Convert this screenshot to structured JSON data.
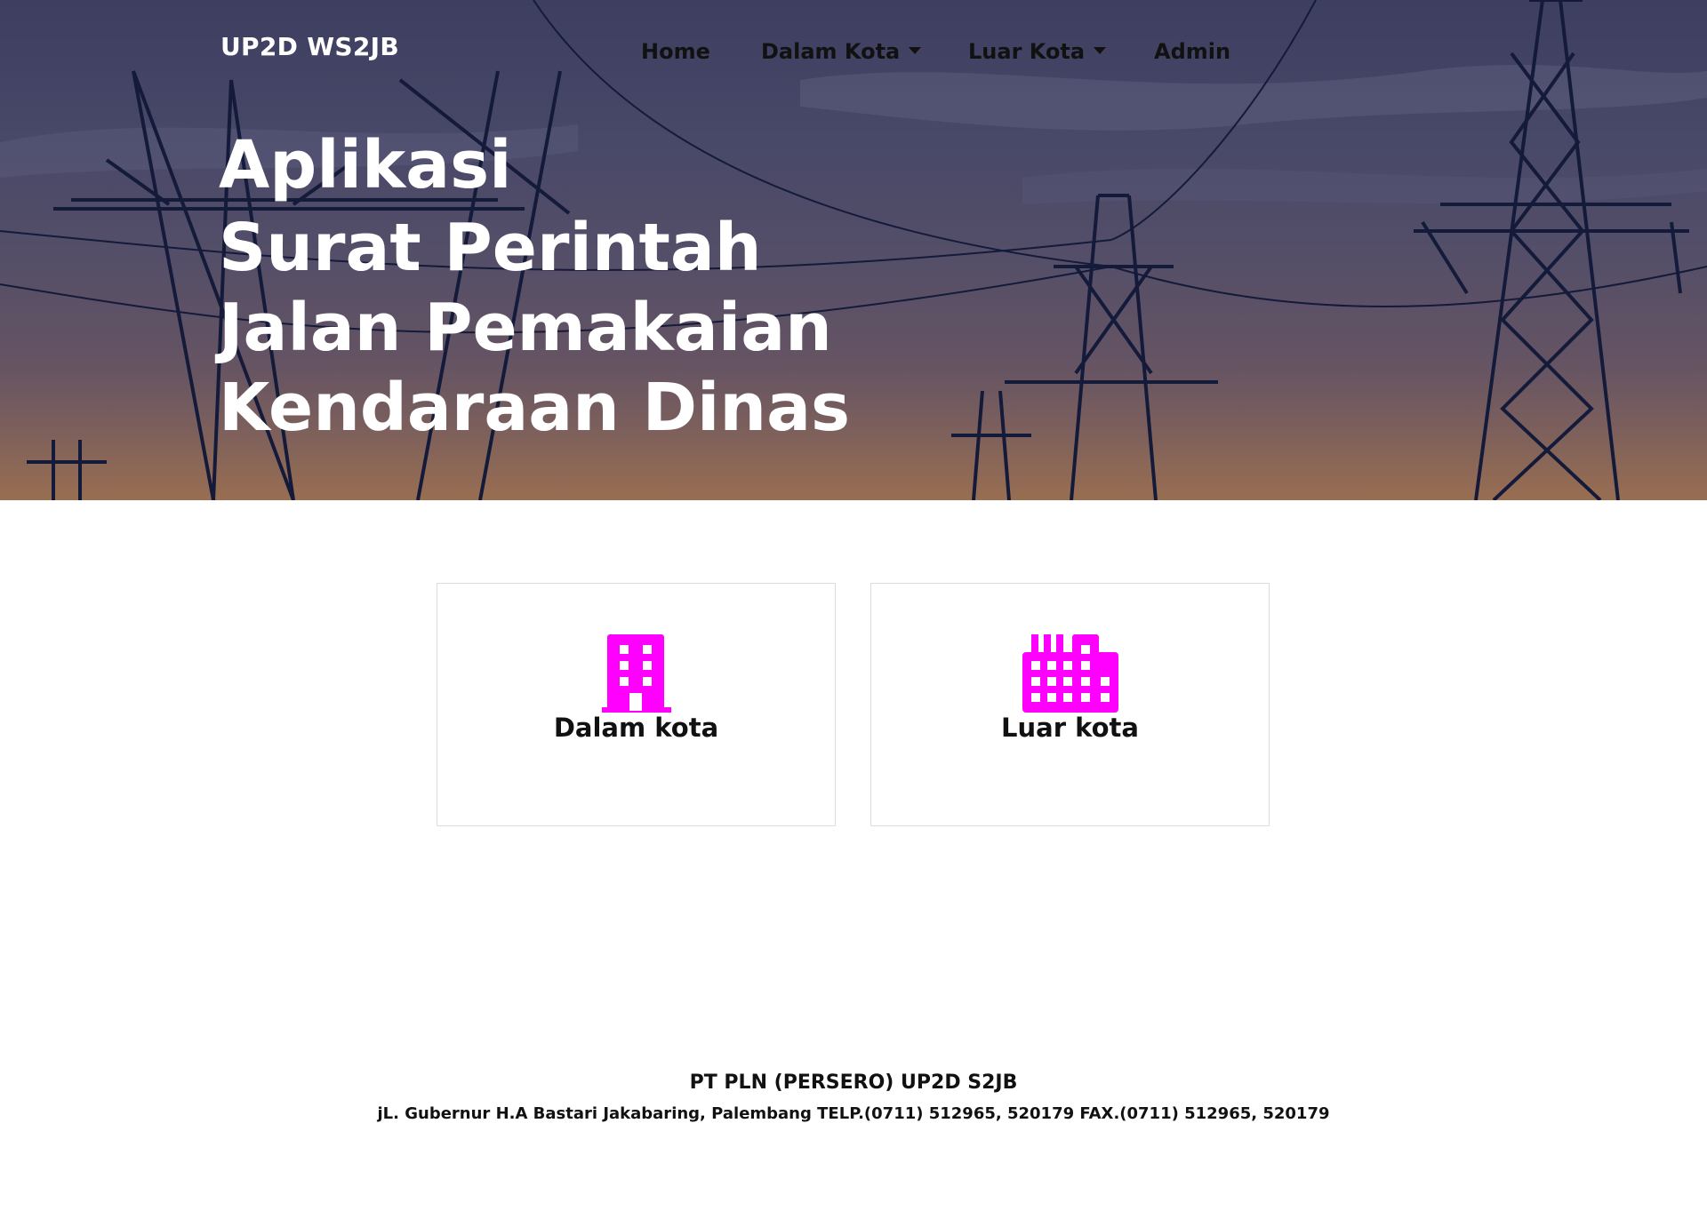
{
  "navbar": {
    "brand": "UP2D WS2JB",
    "items": [
      {
        "label": "Home",
        "dropdown": false
      },
      {
        "label": "Dalam Kota",
        "dropdown": true
      },
      {
        "label": "Luar Kota",
        "dropdown": true
      },
      {
        "label": "Admin",
        "dropdown": false
      }
    ]
  },
  "hero": {
    "line1": "Aplikasi",
    "line2": "Surat Perintah Jalan Pemakaian Kendaraan Dinas",
    "background_icon": "power-transmission-towers"
  },
  "cards": [
    {
      "label": "Dalam kota",
      "icon": "building-icon",
      "icon_color": "#ff00ff"
    },
    {
      "label": "Luar kota",
      "icon": "industry-icon",
      "icon_color": "#ff00ff"
    }
  ],
  "footer": {
    "title": "PT PLN (PERSERO) UP2D S2JB",
    "address": "jL. Gubernur H.A Bastari Jakabaring, Palembang TELP.(0711) 512965, 520179 FAX.(0711) 512965, 520179"
  },
  "colors": {
    "accent": "#ff00ff",
    "hero_overlay": "#44456a",
    "text_dark": "#111111"
  }
}
